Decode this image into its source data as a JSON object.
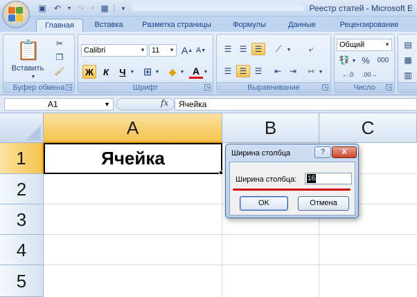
{
  "window": {
    "title": "Реестр статей - Microsoft E"
  },
  "ribbon": {
    "tabs": [
      "Главная",
      "Вставка",
      "Разметка страницы",
      "Формулы",
      "Данные",
      "Рецензирование"
    ],
    "groups": {
      "clipboard": {
        "label": "Буфер обмена",
        "paste": "Вставить"
      },
      "font": {
        "label": "Шрифт",
        "font_name": "Calibri",
        "font_size": "11",
        "bold": "Ж",
        "italic": "К",
        "underline": "Ч",
        "grow": "A",
        "shrink": "A"
      },
      "alignment": {
        "label": "Выравнивание"
      },
      "number": {
        "label": "Число",
        "format": "Общий",
        "percent": "%",
        "thousands": "000"
      }
    }
  },
  "formula_bar": {
    "name_box": "A1",
    "fx": "fx",
    "content": "Ячейка"
  },
  "sheet": {
    "columns": [
      "A",
      "B",
      "C"
    ],
    "rows": [
      "1",
      "2",
      "3",
      "4",
      "5"
    ],
    "cell_a1": "Ячейка"
  },
  "dialog": {
    "title": "Ширина столбца",
    "help": "?",
    "close": "X",
    "label": "Ширина столбца:",
    "value": "16",
    "ok": "OK",
    "cancel": "Отмена"
  },
  "colors": {
    "accent_red": "#d40000",
    "selected_header": "#f5c24f",
    "ribbon_bg": "#d7e4f5"
  }
}
